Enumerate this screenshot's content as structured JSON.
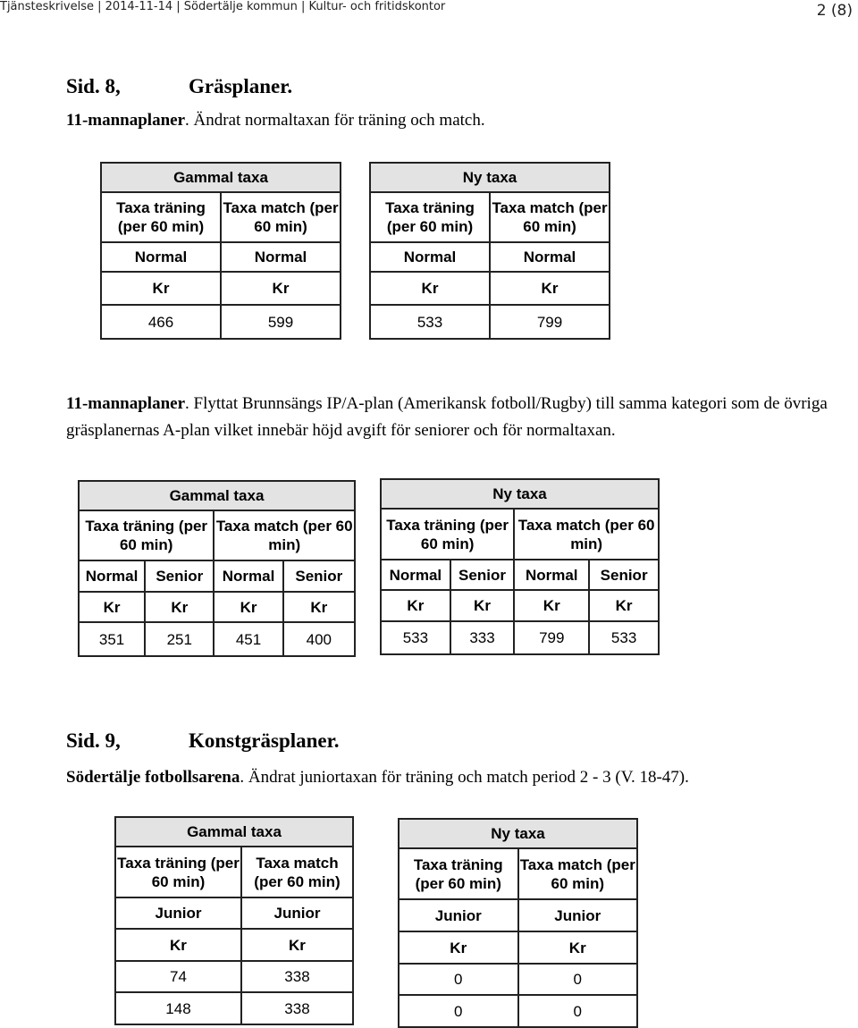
{
  "header": {
    "left": "Tjänsteskrivelse | 2014-11-14 | Södertälje kommun | Kultur- och fritidskontor",
    "page": "2 (8)"
  },
  "section1": {
    "sid": "Sid. 8,",
    "title": "Gräsplaner.",
    "intro_bold": "11-mannaplaner",
    "intro_rest": ". Ändrat normaltaxan för träning och match.",
    "old": {
      "title": "Gammal taxa",
      "cols": [
        "Taxa träning (per 60 min)",
        "Taxa match (per 60 min)"
      ],
      "category": [
        "Normal",
        "Normal"
      ],
      "unit": [
        "Kr",
        "Kr"
      ],
      "values": [
        "466",
        "599"
      ]
    },
    "new": {
      "title": "Ny taxa",
      "cols": [
        "Taxa träning (per 60 min)",
        "Taxa match (per 60 min)"
      ],
      "category": [
        "Normal",
        "Normal"
      ],
      "unit": [
        "Kr",
        "Kr"
      ],
      "values": [
        "533",
        "799"
      ]
    }
  },
  "section2": {
    "intro_bold": "11-mannaplaner",
    "intro_rest": ". Flyttat Brunnsängs IP/A-plan (Amerikansk fotboll/Rugby) till samma kategori som de övriga gräsplanernas A-plan vilket innebär höjd avgift för seniorer och för normaltaxan.",
    "old": {
      "title": "Gammal taxa",
      "cols": [
        "Taxa träning (per 60 min)",
        "Taxa match (per 60 min)"
      ],
      "category": [
        "Normal",
        "Senior",
        "Normal",
        "Senior"
      ],
      "unit": [
        "Kr",
        "Kr",
        "Kr",
        "Kr"
      ],
      "values": [
        "351",
        "251",
        "451",
        "400"
      ]
    },
    "new": {
      "title": "Ny taxa",
      "cols": [
        "Taxa träning (per 60 min)",
        "Taxa match (per 60 min)"
      ],
      "category": [
        "Normal",
        "Senior",
        "Normal",
        "Senior"
      ],
      "unit": [
        "Kr",
        "Kr",
        "Kr",
        "Kr"
      ],
      "values": [
        "533",
        "333",
        "799",
        "533"
      ]
    }
  },
  "section3": {
    "sid": "Sid. 9,",
    "title": "Konstgräsplaner.",
    "intro_bold": "Södertälje fotbollsarena",
    "intro_rest": ". Ändrat juniortaxan för träning och match period 2 - 3 (V. 18-47).",
    "old": {
      "title": "Gammal taxa",
      "cols": [
        "Taxa träning (per 60 min)",
        "Taxa match (per 60 min)"
      ],
      "category": [
        "Junior",
        "Junior"
      ],
      "unit": [
        "Kr",
        "Kr"
      ],
      "values": [
        [
          "74",
          "338"
        ],
        [
          "148",
          "338"
        ]
      ]
    },
    "new": {
      "title": "Ny taxa",
      "cols": [
        "Taxa träning (per 60 min)",
        "Taxa match (per 60 min)"
      ],
      "category": [
        "Junior",
        "Junior"
      ],
      "unit": [
        "Kr",
        "Kr"
      ],
      "values": [
        [
          "0",
          "0"
        ],
        [
          "0",
          "0"
        ]
      ]
    }
  }
}
